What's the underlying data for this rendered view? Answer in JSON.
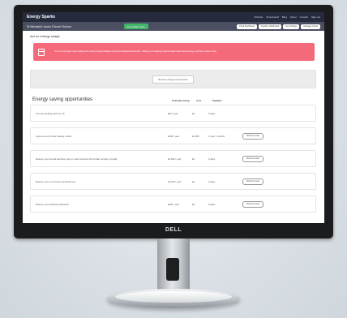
{
  "monitor": {
    "brand": "DELL"
  },
  "app": {
    "title": "Energy Sparks",
    "nav": [
      "Schools",
      "Scoreboard",
      "Blog",
      "About",
      "Contact",
      "Sign out"
    ]
  },
  "subheader": {
    "school": "St Michael's Junior Church School",
    "badge": "Eco petition open",
    "buttons": [
      "Pupil dashboard",
      "Teacher dashboard",
      "Key findings",
      "Manage school"
    ]
  },
  "page": {
    "title": "Act on energy usage",
    "alert": "Your school spent more heating the school during holidays and at the weekend last winter. Setting your heating controls better could save energy, and help reduce costs.",
    "chart_button": "Remove energy consumption"
  },
  "opportunities": {
    "title": "Energy saving opportunities",
    "headers": [
      "Potential saving",
      "Cost",
      "Payback"
    ],
    "rows": [
      {
        "desc": "Turn the heating down by 1C",
        "saving": "£95 / year",
        "cost": "£0",
        "payback": "0 days",
        "action": ""
      },
      {
        "desc": "Improve your school heating control",
        "saving": "£150 / year",
        "cost": "£3,000",
        "payback": "1 year 7 months",
        "action": "Find out more"
      },
      {
        "desc": "Reduce your annual electricity use to match schools with similar number of pupils",
        "saving": "£4,600 / year",
        "cost": "£0",
        "payback": "0 days",
        "action": "Find out more"
      },
      {
        "desc": "Reduce your out of hours electricity use",
        "saving": "£1,100 / year",
        "cost": "£0",
        "payback": "0 days",
        "action": "Find out more"
      },
      {
        "desc": "Reduce your electricity baseload",
        "saving": "£620 / year",
        "cost": "£0",
        "payback": "0 days",
        "action": "Find out more"
      }
    ]
  },
  "colors": {
    "topbar": "#252a3d",
    "subbar": "#4a4f62",
    "alert": "#f56a7a",
    "badge": "#43b36a"
  }
}
